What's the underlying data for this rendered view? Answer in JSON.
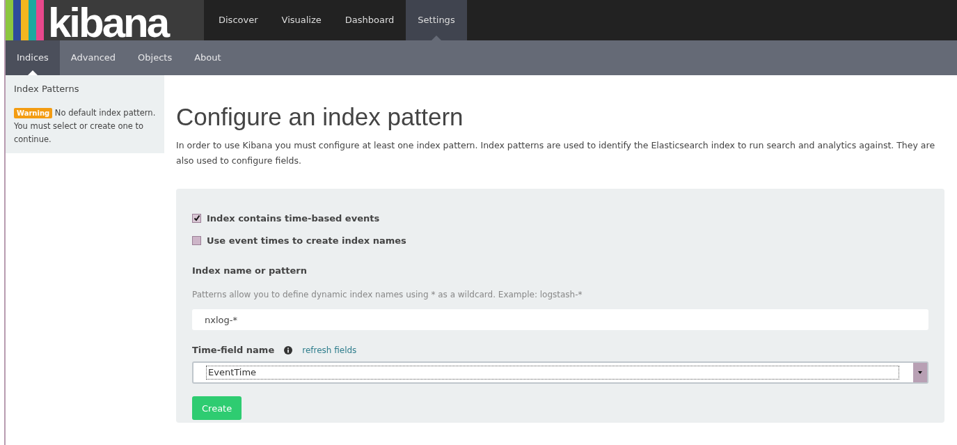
{
  "logo": {
    "text": "kibana"
  },
  "nav": [
    {
      "label": "Discover",
      "selected": false
    },
    {
      "label": "Visualize",
      "selected": false
    },
    {
      "label": "Dashboard",
      "selected": false
    },
    {
      "label": "Settings",
      "selected": true
    }
  ],
  "subnav": [
    {
      "label": "Indices",
      "selected": true
    },
    {
      "label": "Advanced",
      "selected": false
    },
    {
      "label": "Objects",
      "selected": false
    },
    {
      "label": "About",
      "selected": false
    }
  ],
  "sidebar": {
    "title": "Index Patterns",
    "badge": "Warning",
    "message": "No default index pattern. You must select or create one to continue."
  },
  "main": {
    "heading": "Configure an index pattern",
    "intro": "In order to use Kibana you must configure at least one index pattern. Index patterns are used to identify the Elasticsearch index to run search and analytics against. They are also used to configure fields.",
    "checkboxes": [
      {
        "label": "Index contains time-based events",
        "checked": true
      },
      {
        "label": "Use event times to create index names",
        "checked": false
      }
    ],
    "pattern_label": "Index name or pattern",
    "pattern_help": "Patterns allow you to define dynamic index names using * as a wildcard. Example: logstash-*",
    "pattern_value": "nxlog-*",
    "time_label": "Time-field name",
    "refresh_link": "refresh fields",
    "time_value": "EventTime",
    "create_button": "Create"
  }
}
